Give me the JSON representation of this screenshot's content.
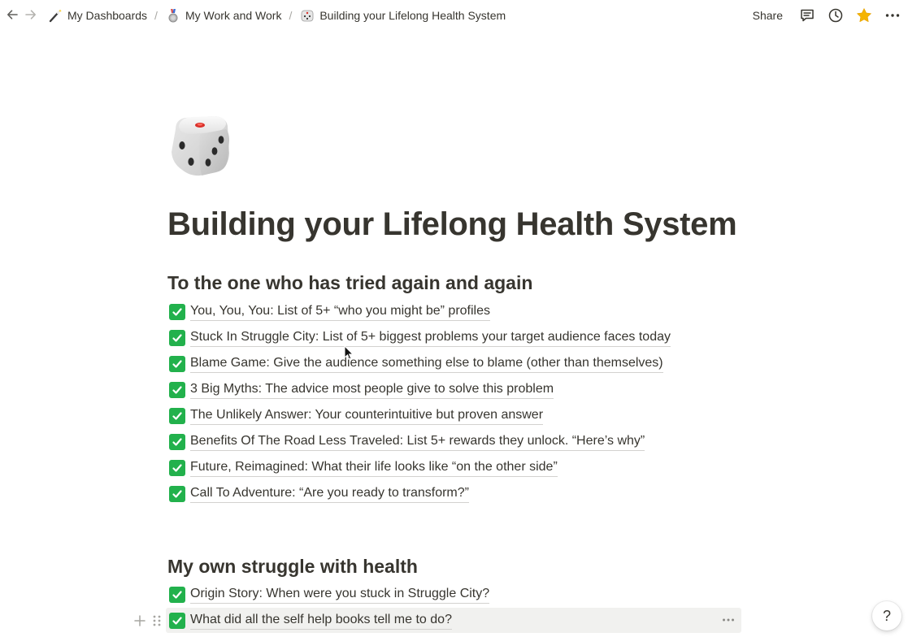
{
  "breadcrumbs": [
    {
      "label": "My Dashboards",
      "icon": "magic-wand-icon"
    },
    {
      "label": "My Work and Work",
      "icon": "medal-icon"
    },
    {
      "label": "Building your Lifelong Health System",
      "icon": "dice-icon"
    }
  ],
  "separator": "/",
  "topbar": {
    "share_label": "Share",
    "icons": [
      "back-arrow-icon",
      "forward-arrow-icon",
      "comment-icon",
      "clock-icon",
      "star-icon",
      "more-icon"
    ]
  },
  "page": {
    "icon": "dice-icon",
    "title": "Building your Lifelong Health System",
    "sections": [
      {
        "heading": "To the one who has tried again and again",
        "items": [
          "You, You, You: List of 5+ “who you might be” profiles",
          "Stuck In Struggle City: List of 5+ biggest problems your target audience faces today",
          "Blame Game: Give the audience something else to blame (other than themselves)",
          "3 Big Myths: The advice most people give to solve this problem",
          "The Unlikely Answer: Your counterintuitive but proven answer",
          "Benefits Of The Road Less Traveled: List 5+ rewards they unlock. “Here’s why”",
          "Future, Reimagined: What their life looks like “on the other side”",
          "Call To Adventure: “Are you ready to transform?”"
        ]
      },
      {
        "heading": "My own struggle with health",
        "items": [
          "Origin Story: When were you stuck in Struggle City?",
          "What did all the self help books tell me to do?"
        ]
      }
    ]
  },
  "help_label": "?",
  "colors": {
    "check_green": "#22b14c",
    "star": "#f5b400",
    "text": "#37352f",
    "hover": "#f1f1ef"
  }
}
